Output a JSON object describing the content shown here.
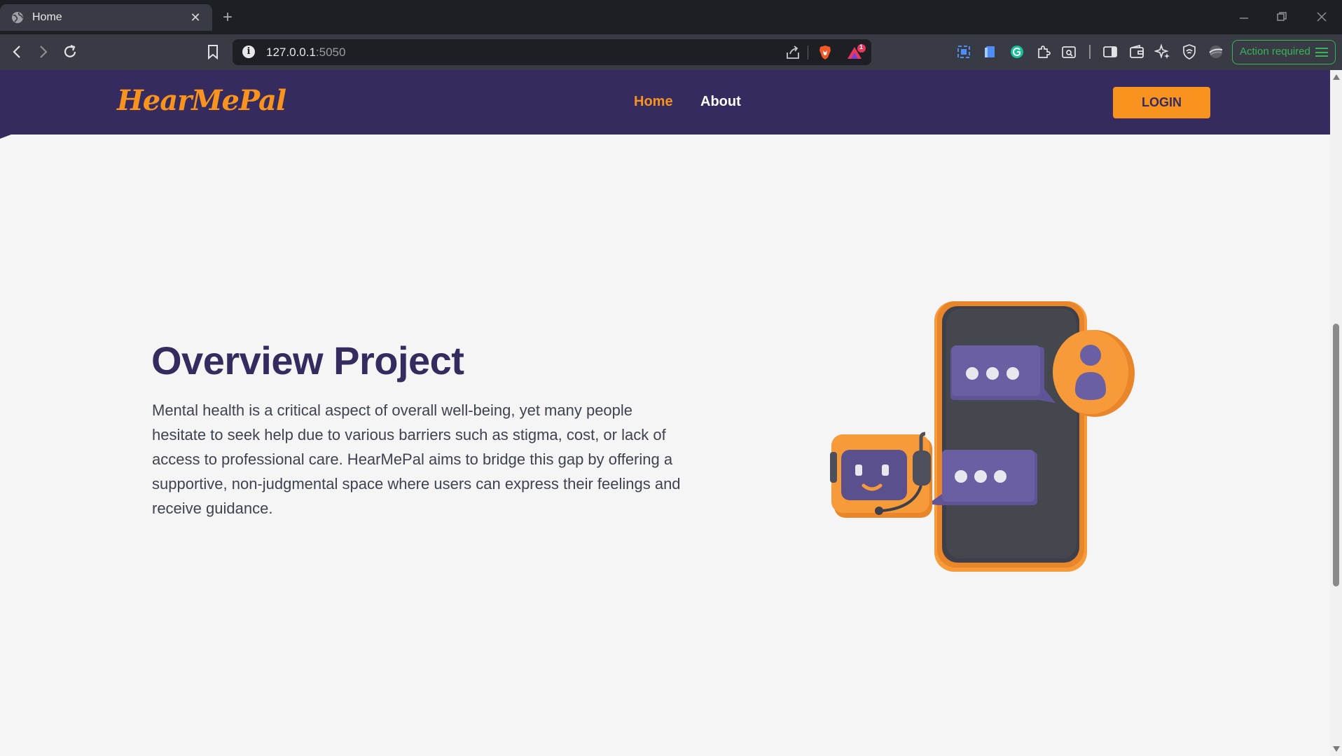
{
  "browser": {
    "tab_title": "Home",
    "tab_close": "✕",
    "new_tab": "+",
    "url_host": "127.0.0.1",
    "url_port": ":5050",
    "action_required": "Action required",
    "notification_count": "1"
  },
  "site": {
    "logo": "HearMePal",
    "nav": {
      "home": "Home",
      "about": "About"
    },
    "login_label": "LOGIN"
  },
  "overview": {
    "title": "Overview Project",
    "body": "Mental health is a critical aspect of overall well-being, yet many people hesitate to seek help due to various barriers such as stigma, cost, or lack of access to professional care. HearMePal aims to bridge this gap by offering a supportive, non-judgmental space where users can express their feelings and receive guidance."
  },
  "colors": {
    "brand_purple": "#352b5e",
    "brand_orange": "#f7931e",
    "page_bg": "#f5f5f5"
  }
}
